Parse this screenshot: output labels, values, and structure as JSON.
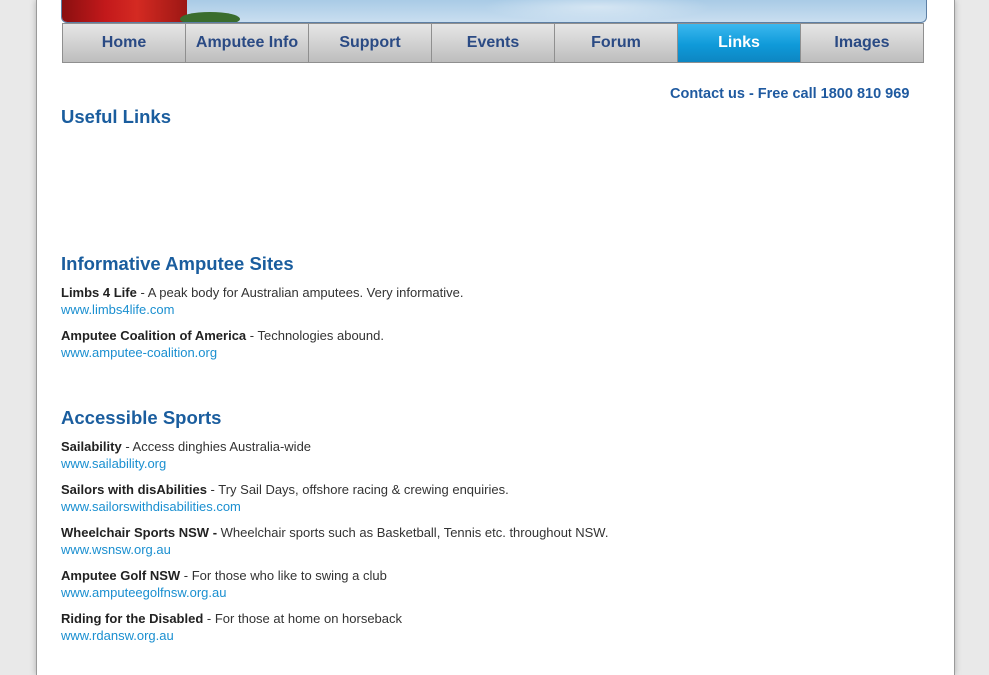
{
  "nav": {
    "items": [
      {
        "label": "Home",
        "active": false
      },
      {
        "label": "Amputee Info",
        "active": false
      },
      {
        "label": "Support",
        "active": false
      },
      {
        "label": "Events",
        "active": false
      },
      {
        "label": "Forum",
        "active": false
      },
      {
        "label": "Links",
        "active": true
      },
      {
        "label": "Images",
        "active": false
      }
    ]
  },
  "contact": "Contact us - Free call 1800 810 969",
  "page_title": "Useful Links",
  "sections": [
    {
      "heading": "Informative Amputee Sites",
      "entries": [
        {
          "name": "Limbs 4 Life",
          "sep": " - ",
          "desc": "A peak body for Australian amputees.  Very informative.",
          "url": "www.limbs4life.com"
        },
        {
          "name": "Amputee Coalition of America",
          "sep": " - ",
          "desc": "Technologies abound.",
          "url": "www.amputee-coalition.org"
        }
      ]
    },
    {
      "heading": "Accessible Sports",
      "entries": [
        {
          "name": "Sailability",
          "sep": " - ",
          "desc": "Access dinghies Australia-wide",
          "url": "www.sailability.org"
        },
        {
          "name": "Sailors with disAbilities",
          "sep": " - ",
          "desc": "Try Sail Days, offshore racing & crewing enquiries.",
          "url": "www.sailorswithdisabilities.com"
        },
        {
          "name": "Wheelchair Sports NSW -",
          "sep": " ",
          "desc": "Wheelchair sports such as Basketball, Tennis etc. throughout NSW.",
          "url": "www.wsnsw.org.au"
        },
        {
          "name": "Amputee Golf NSW",
          "sep": " - ",
          "desc": "For those who like to swing a club",
          "url": "www.amputeegolfnsw.org.au"
        },
        {
          "name": "Riding for the Disabled",
          "sep": " - ",
          "desc": "For those at home on horseback",
          "url": "www.rdansw.org.au"
        }
      ]
    }
  ]
}
